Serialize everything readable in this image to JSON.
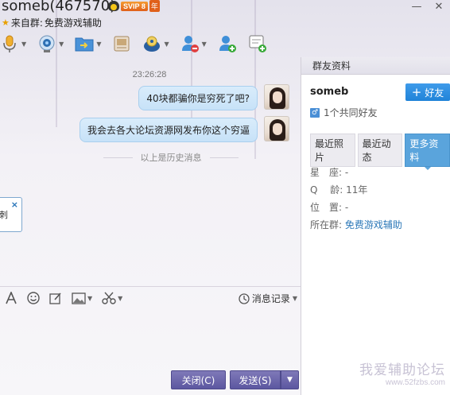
{
  "window": {
    "title": "someb(467570)",
    "vip_badge": "SVIP 8",
    "year_badge": "年",
    "source_label": "来自群:",
    "source_group": "免费游戏辅助",
    "minimize": "—",
    "close": "✕"
  },
  "toolbar": {
    "icons": [
      "microphone-icon",
      "video-camera-icon",
      "file-transfer-icon",
      "screen-share-icon",
      "remote-assist-icon",
      "remove-user-icon",
      "add-user-icon",
      "new-chat-icon"
    ]
  },
  "chat": {
    "timestamp": "23:26:28",
    "messages": [
      {
        "text": "40块都骗你是穷死了吧?"
      },
      {
        "text": "我会去各大论坛资源网发布你这个穷逼"
      }
    ],
    "history_divider": "以上是历史消息",
    "popup_text": "刺",
    "popup_close": "×"
  },
  "input": {
    "history_label": "消息记录",
    "close_label": "关闭(C)",
    "send_label": "发送(S)"
  },
  "panel": {
    "header": "群友资料",
    "nickname": "someb",
    "add_friend": "好友",
    "mutual_friends": "1个共同好友",
    "tabs": [
      {
        "label": "最近照片",
        "active": false
      },
      {
        "label": "最近动态",
        "active": false
      },
      {
        "label": "更多资料",
        "active": true
      }
    ],
    "fields": [
      {
        "label": "星　座:",
        "value": "-"
      },
      {
        "label": "Q　 龄:",
        "value": "11年"
      },
      {
        "label": "位　置:",
        "value": "-"
      },
      {
        "label": "所在群:",
        "value": "免费游戏辅助"
      }
    ]
  },
  "watermark": {
    "title": "我爱辅助论坛",
    "url": "www.52fzbs.com"
  },
  "colors": {
    "bubble": "#cfe6f9",
    "send_button": "#5c57a0",
    "add_button": "#2083d8",
    "link": "#2c78b8"
  }
}
